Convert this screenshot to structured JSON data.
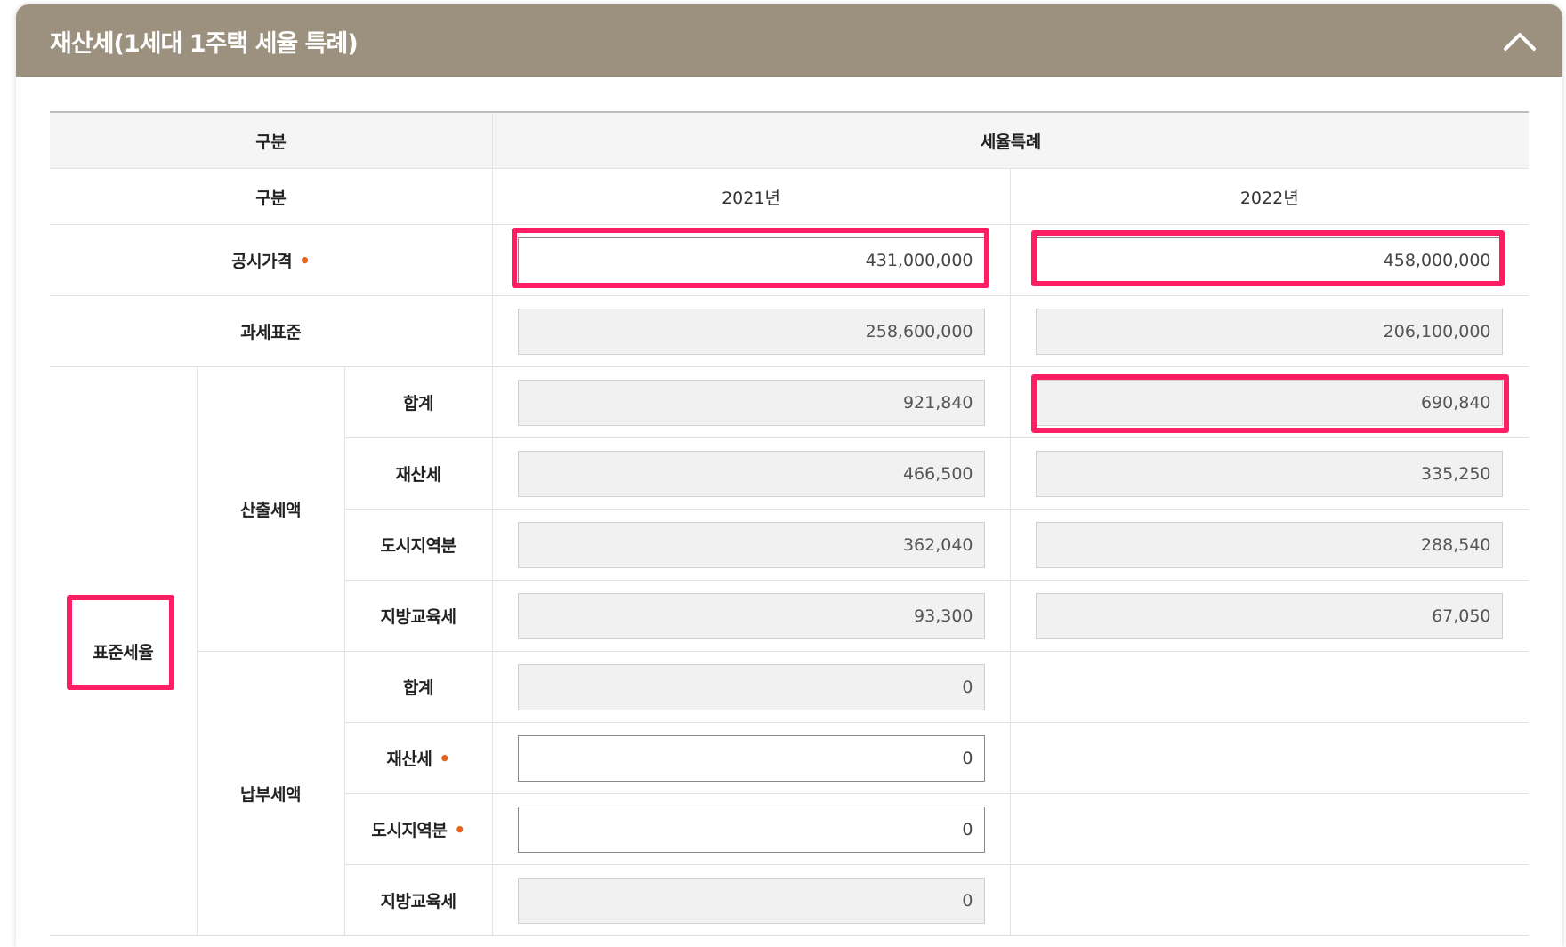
{
  "panel": {
    "title": "재산세(1세대 1주택 세율 특례)"
  },
  "table": {
    "header": {
      "col1": "구분",
      "col2": "세율특례"
    },
    "year_row": {
      "label": "구분",
      "year_2021": "2021년",
      "year_2022": "2022년"
    },
    "rows": {
      "official_price": {
        "label": "공시가격",
        "required_mark": "•",
        "v2021": "431,000,000",
        "v2022": "458,000,000"
      },
      "tax_base": {
        "label": "과세표준",
        "v2021": "258,600,000",
        "v2022": "206,100,000"
      },
      "group_label": "표준세율",
      "calc_label": "산출세액",
      "calc_total": {
        "label": "합계",
        "v2021": "921,840",
        "v2022": "690,840"
      },
      "calc_property": {
        "label": "재산세",
        "v2021": "466,500",
        "v2022": "335,250"
      },
      "calc_urban": {
        "label": "도시지역분",
        "v2021": "362,040",
        "v2022": "288,540"
      },
      "calc_edu": {
        "label": "지방교육세",
        "v2021": "93,300",
        "v2022": "67,050"
      },
      "pay_label": "납부세액",
      "pay_total": {
        "label": "합계",
        "v2021": "0"
      },
      "pay_property": {
        "label": "재산세",
        "required_mark": "•",
        "v2021": "0"
      },
      "pay_urban": {
        "label": "도시지역분",
        "required_mark": "•",
        "v2021": "0"
      },
      "pay_edu": {
        "label": "지방교육세",
        "v2021": "0"
      }
    }
  },
  "colors": {
    "header_bg": "#9c907f",
    "highlight": "#ff1e64",
    "required_dot": "#e8641c"
  }
}
